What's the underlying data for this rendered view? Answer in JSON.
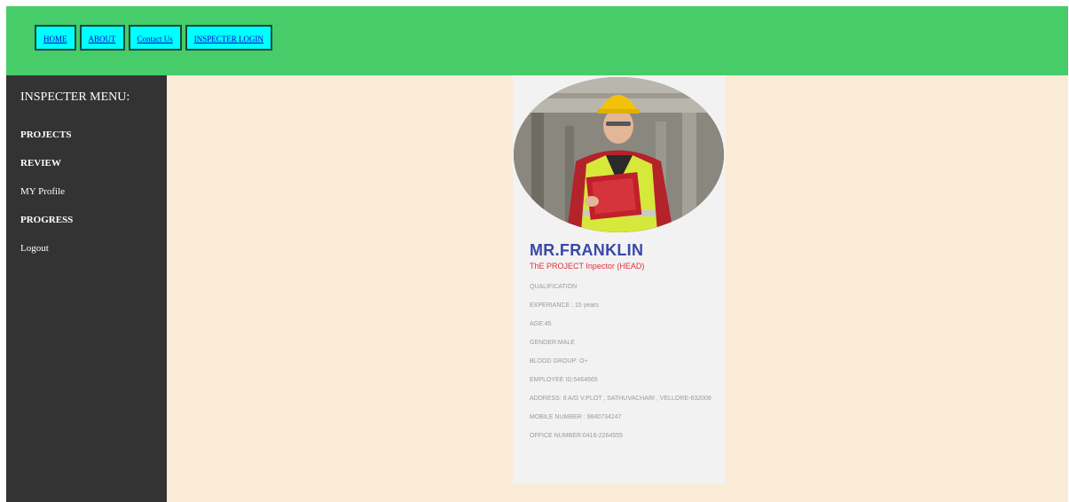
{
  "nav": {
    "items": [
      {
        "label": "HOME"
      },
      {
        "label": "ABOUT"
      },
      {
        "label": "Contact Us"
      },
      {
        "label": "INSPECTER LOGIN"
      }
    ]
  },
  "sidebar": {
    "title": "INSPECTER MENU:",
    "items": [
      {
        "label": "PROJECTS"
      },
      {
        "label": "REVIEW"
      },
      {
        "label": "MY Profile"
      },
      {
        "label": "PROGRESS"
      },
      {
        "label": "Logout"
      }
    ]
  },
  "profile": {
    "name": "MR.FRANKLIN",
    "role": "ThE PROJECT Inpector (HEAD)",
    "details": [
      "QUALIFICATION",
      "EXPERIANCE : 15 years",
      "AGE:45",
      "GENDER:MALE",
      "BLOOD GROUP: O+",
      "EMPLOYEE ID:5464665",
      "ADDRESS: 8 A/G V.PLOT , SATHUVACHARI , VELLORE-632009",
      "MOBILE NUMBER : 9840734247",
      "OFFICE NUMBER:0416-2264555"
    ]
  },
  "colors": {
    "topbar": "#47cc6a",
    "sidebar": "#333333",
    "background": "#faebd7",
    "nav_button": "#00ffff",
    "name": "#3848a6",
    "role": "#e0303a"
  }
}
